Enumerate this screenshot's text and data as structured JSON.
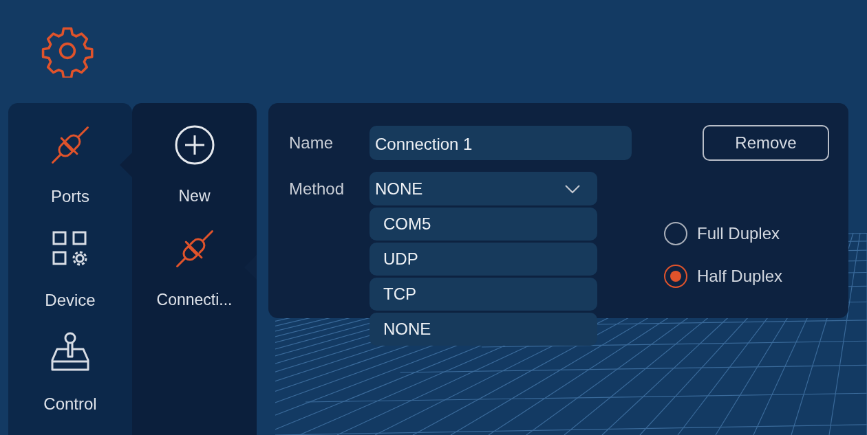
{
  "sidebar": {
    "items": [
      {
        "label": "Ports",
        "kind": "plug",
        "selected": true
      },
      {
        "label": "Device",
        "kind": "device",
        "selected": false
      },
      {
        "label": "Control",
        "kind": "joystick",
        "selected": false
      }
    ]
  },
  "subnav": {
    "items": [
      {
        "label": "New",
        "kind": "add",
        "selected": false
      },
      {
        "label": "Connecti...",
        "kind": "plug",
        "selected": true
      }
    ]
  },
  "form": {
    "name_label": "Name",
    "name_value": "Connection 1",
    "method_label": "Method",
    "method_value": "NONE",
    "method_expanded": true,
    "method_options": [
      "COM5",
      "UDP",
      "TCP",
      "NONE"
    ],
    "remove_button": "Remove",
    "duplex": [
      {
        "label": "Full Duplex",
        "selected": false
      },
      {
        "label": "Half Duplex",
        "selected": true
      }
    ]
  }
}
